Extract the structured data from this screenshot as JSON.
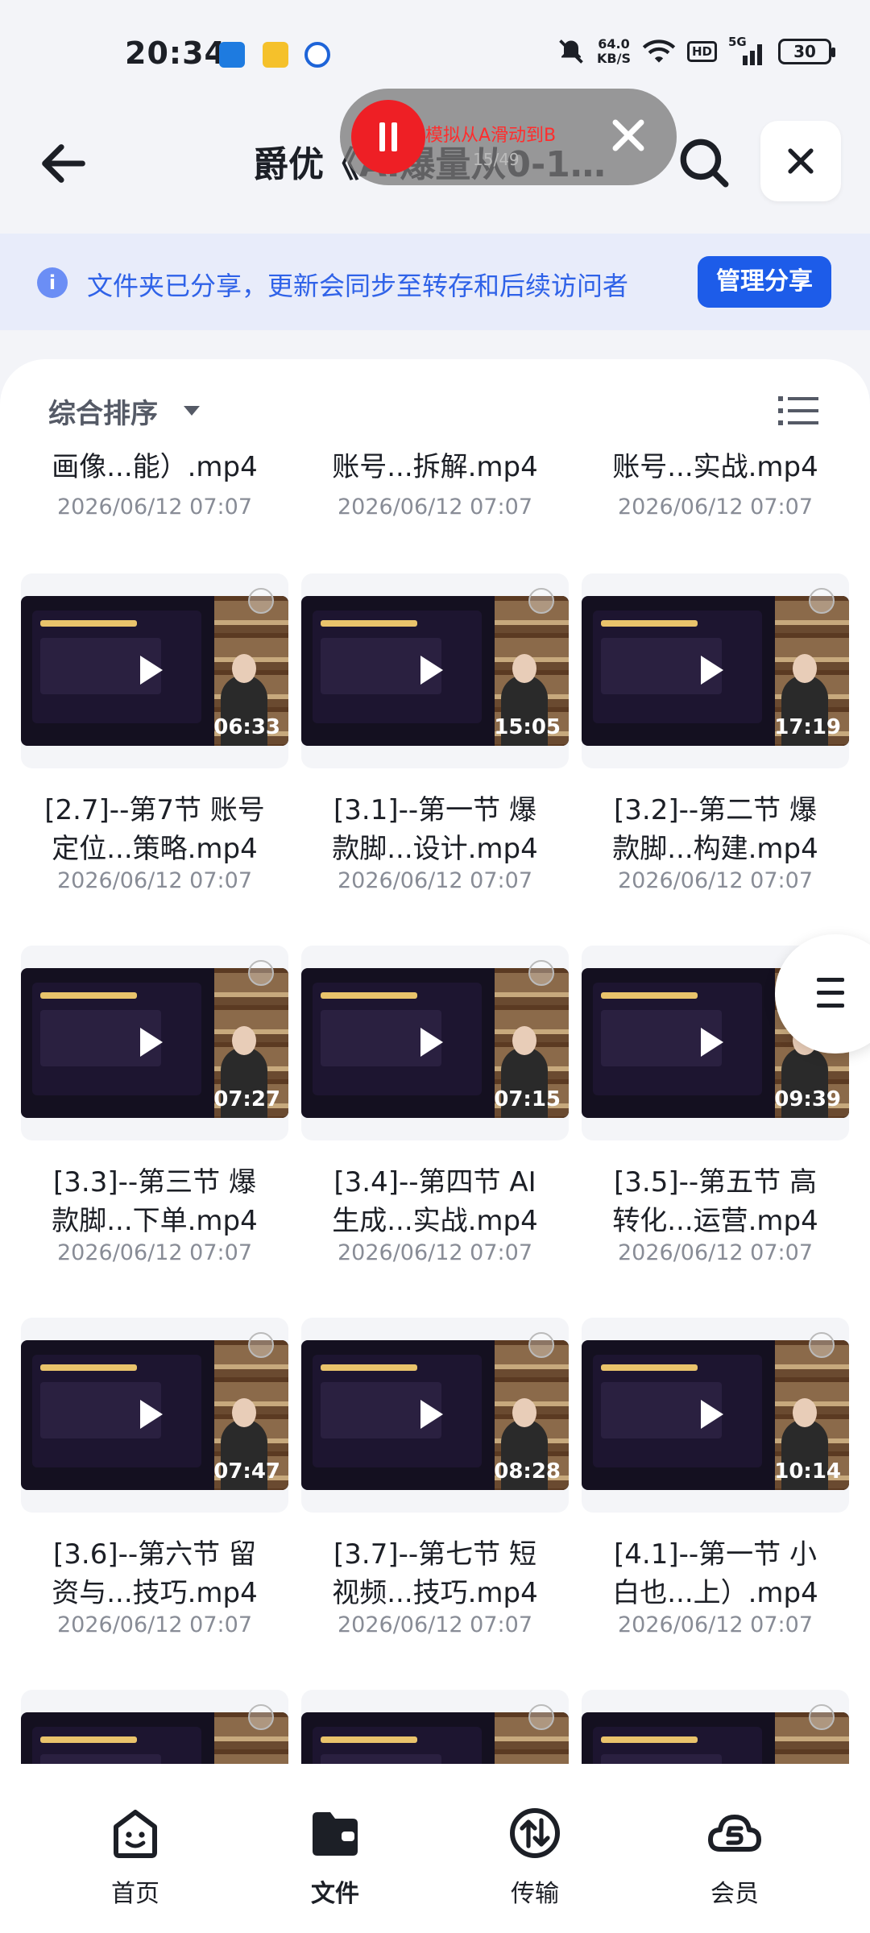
{
  "status_bar": {
    "time": "20:34",
    "net_speed_value": "64.0",
    "net_speed_unit": "KB/S",
    "hd_badge": "HD",
    "signal": "5G",
    "battery": "30"
  },
  "header": {
    "title": "爵优《AI爆量从0-1…",
    "back_icon": "arrow-left-icon",
    "search_icon": "search-icon",
    "close_icon": "close-icon"
  },
  "overlay": {
    "text": "模拟从A滑动到B",
    "counter": "15/49"
  },
  "share_banner": {
    "text": "文件夹已分享，更新会同步至转存和后续访问者",
    "button": "管理分享",
    "accent": "#1d5ce9"
  },
  "sort": {
    "label": "综合排序"
  },
  "top_partial_row": [
    {
      "name": "画像...能）.mp4",
      "date": "2026/06/12 07:07"
    },
    {
      "name": "账号...拆解.mp4",
      "date": "2026/06/12 07:07"
    },
    {
      "name": "账号...实战.mp4",
      "date": "2026/06/12 07:07"
    }
  ],
  "files": [
    {
      "name_line1": "[2.7]--第7节 账号",
      "name_line2": "定位...策略.mp4",
      "date": "2026/06/12 07:07",
      "duration": "06:33"
    },
    {
      "name_line1": "[3.1]--第一节 爆",
      "name_line2": "款脚...设计.mp4",
      "date": "2026/06/12 07:07",
      "duration": "15:05"
    },
    {
      "name_line1": "[3.2]--第二节 爆",
      "name_line2": "款脚...构建.mp4",
      "date": "2026/06/12 07:07",
      "duration": "17:19"
    },
    {
      "name_line1": "[3.3]--第三节 爆",
      "name_line2": "款脚...下单.mp4",
      "date": "2026/06/12 07:07",
      "duration": "07:27"
    },
    {
      "name_line1": "[3.4]--第四节 AI",
      "name_line2": "生成...实战.mp4",
      "date": "2026/06/12 07:07",
      "duration": "07:15"
    },
    {
      "name_line1": "[3.5]--第五节 高",
      "name_line2": "转化...运营.mp4",
      "date": "2026/06/12 07:07",
      "duration": "09:39"
    },
    {
      "name_line1": "[3.6]--第六节 留",
      "name_line2": "资与...技巧.mp4",
      "date": "2026/06/12 07:07",
      "duration": "07:47"
    },
    {
      "name_line1": "[3.7]--第七节 短",
      "name_line2": "视频...技巧.mp4",
      "date": "2026/06/12 07:07",
      "duration": "08:28"
    },
    {
      "name_line1": "[4.1]--第一节 小",
      "name_line2": "白也...上）.mp4",
      "date": "2026/06/12 07:07",
      "duration": "10:14"
    }
  ],
  "bottom_nav": [
    {
      "label": "首页",
      "icon": "home-face-icon"
    },
    {
      "label": "文件",
      "icon": "folder-icon"
    },
    {
      "label": "传输",
      "icon": "transfer-icon"
    },
    {
      "label": "会员",
      "icon": "member-cloud-icon"
    }
  ]
}
